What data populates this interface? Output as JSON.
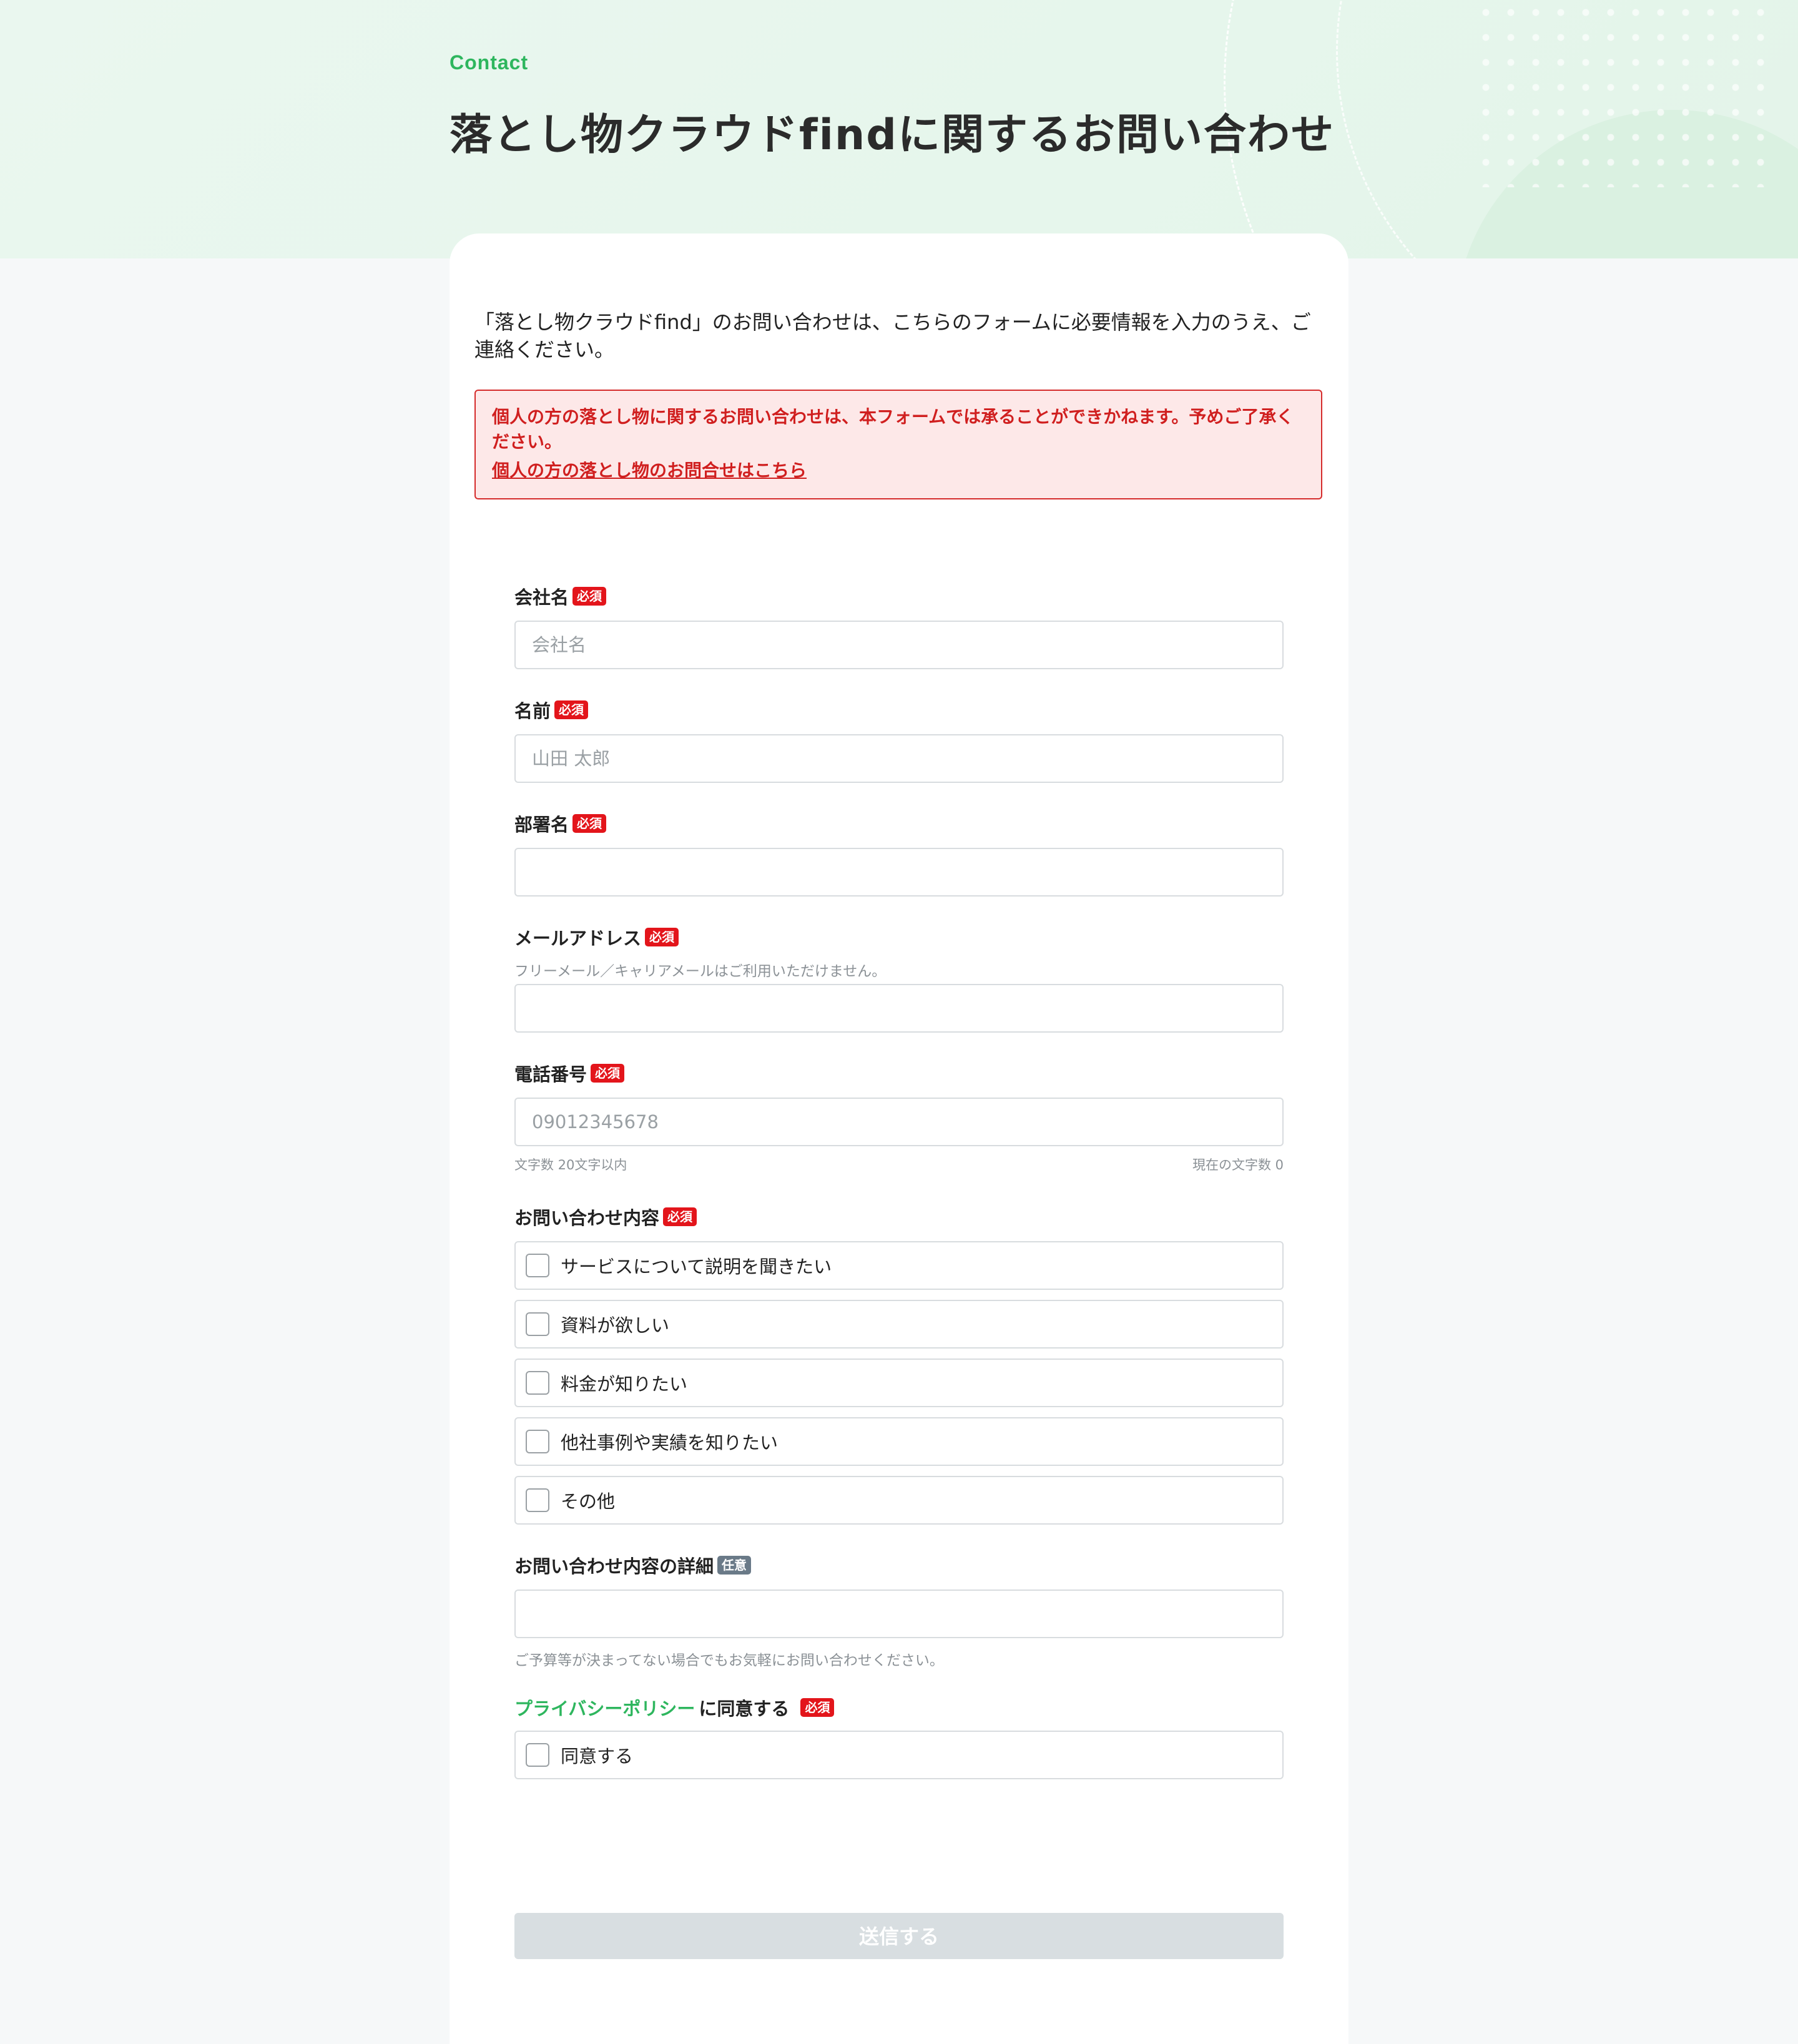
{
  "hero": {
    "eyebrow": "Contact",
    "title": "落とし物クラウドfindに関するお問い合わせ"
  },
  "intro": "「落とし物クラウドfind」のお問い合わせは、こちらのフォームに必要情報を入力のうえ、ご連絡ください。",
  "alert": {
    "message": "個人の方の落とし物に関するお問い合わせは、本フォームでは承ることができかねます。予めご了承ください。",
    "link": "個人の方の落とし物のお問合せはこちら"
  },
  "badges": {
    "required": "必須",
    "optional": "任意"
  },
  "form": {
    "company": {
      "label": "会社名",
      "placeholder": "会社名"
    },
    "name": {
      "label": "名前",
      "placeholder": "山田 太郎"
    },
    "department": {
      "label": "部署名",
      "placeholder": ""
    },
    "email": {
      "label": "メールアドレス",
      "note": "フリーメール／キャリアメールはご利用いただけません。",
      "placeholder": ""
    },
    "phone": {
      "label": "電話番号",
      "placeholder": "09012345678",
      "limit_note": "文字数 20文字以内",
      "count_note": "現在の文字数 0"
    },
    "inquiry": {
      "label": "お問い合わせ内容",
      "options": [
        "サービスについて説明を聞きたい",
        "資料が欲しい",
        "料金が知りたい",
        "他社事例や実績を知りたい",
        "その他"
      ]
    },
    "details": {
      "label": "お問い合わせ内容の詳細",
      "placeholder": "",
      "note": "ご予算等が決まってない場合でもお気軽にお問い合わせください。"
    },
    "privacy": {
      "link": "プライバシーポリシー",
      "label_suffix": "に同意する",
      "option": "同意する"
    },
    "submit": "送信する"
  }
}
